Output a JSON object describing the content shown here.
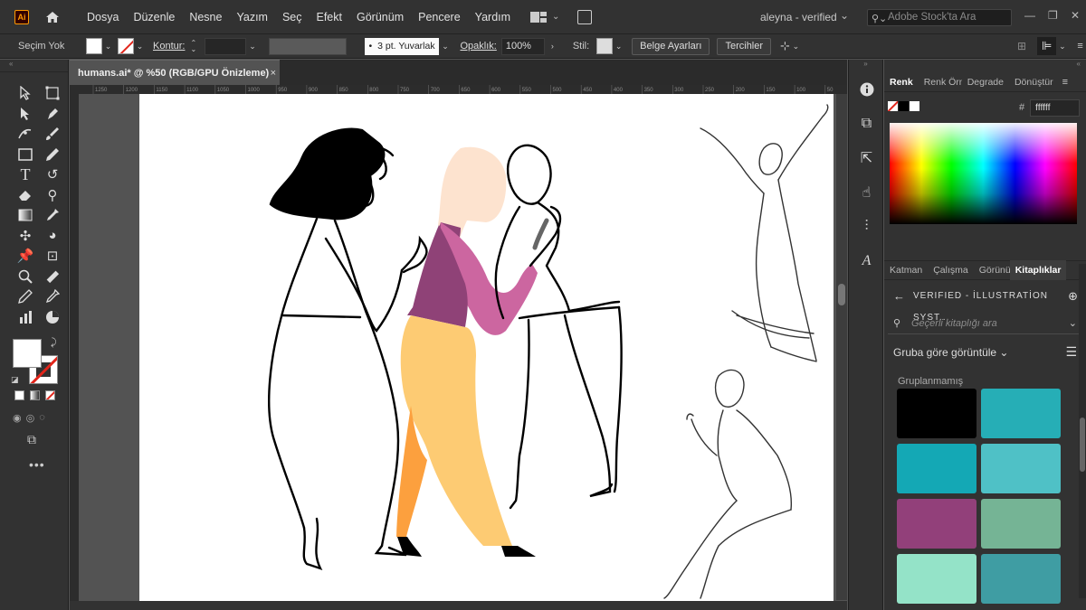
{
  "app": {
    "logo_text": "Ai",
    "menu": [
      "Dosya",
      "Düzenle",
      "Nesne",
      "Yazım",
      "Seç",
      "Efekt",
      "Görünüm",
      "Pencere",
      "Yardım"
    ],
    "account": "aleyna - verified",
    "stock_search_placeholder": "Adobe Stock'ta Ara"
  },
  "control_bar": {
    "selection_label": "Seçim Yok",
    "stroke_label": "Kontur:",
    "brush_label": "3 pt. Yuvarlak",
    "opacity_label": "Opaklık:",
    "opacity_value": "100%",
    "style_label": "Stil:",
    "doc_settings_button": "Belge Ayarları",
    "preferences_button": "Tercihler"
  },
  "document": {
    "tab_title": "humans.ai* @ %50 (RGB/GPU Önizleme)",
    "close_glyph": "×",
    "ruler_ticks": [
      "1250",
      "1200",
      "1150",
      "1100",
      "1050",
      "1000",
      "950",
      "900",
      "850",
      "800",
      "750",
      "700",
      "650",
      "600",
      "550",
      "500",
      "450",
      "400",
      "350",
      "300",
      "250",
      "200",
      "150",
      "100",
      "50"
    ]
  },
  "tools": [
    "selection-tool-icon",
    "direct-selection-icon",
    "direct-select-arrow-icon",
    "pen-tool-icon",
    "curvature-tool-icon",
    "paintbrush-icon",
    "rectangle-tool-icon",
    "pencil-tool-icon",
    "type-tool-icon",
    "rotate-tool-icon",
    "eraser-tool-icon",
    "lasso-tool-icon",
    "gradient-tool-icon",
    "eyedropper-tool-icon",
    "puppet-warp-icon",
    "shape-builder-icon",
    "pin-tool-icon",
    "artboard-tool-icon",
    "zoom-tool-icon",
    "ruler-tool-icon",
    "pencil-alt-icon",
    "eyedropper-alt-icon",
    "graph-tool-icon",
    "pie-chart-icon"
  ],
  "color_panel": {
    "tabs": [
      "Renk",
      "Renk Örnekleri",
      "Degrade",
      "Dönüştür"
    ],
    "hex_label": "#",
    "hex_value": "ffffff"
  },
  "libraries_panel": {
    "tabs": [
      "Katman",
      "Çalışma",
      "Görünüm",
      "Kitaplıklar"
    ],
    "library_name": "VERIFIED - İLLUSTRATİON SYST...",
    "search_placeholder": "Geçerli kitaplığı ara",
    "group_by_label": "Gruba göre görüntüle",
    "ungrouped_label": "Gruplanmamış",
    "swatches": [
      "#000000",
      "#26aeb6",
      "#14a8b5",
      "#4fc1c6",
      "#92407a",
      "#75b495",
      "#94e3c8",
      "#3f9da3"
    ]
  },
  "illustration": {
    "colors": {
      "skin": "#fde3cf",
      "shirt_dark": "#8f4277",
      "shirt_light": "#cc66a0",
      "pants_light": "#fdcb73",
      "pants_dark": "#fca03e",
      "line": "#000000"
    }
  }
}
